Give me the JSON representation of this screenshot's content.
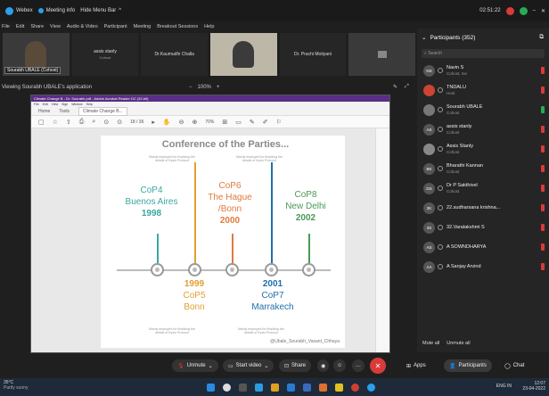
{
  "topbar": {
    "webex": "Webex",
    "meeting_info": "Meeting info",
    "hide_menu": "Hide Menu Bar",
    "time": "02:51:22"
  },
  "menu": [
    "File",
    "Edit",
    "Share",
    "View",
    "Audio & Video",
    "Participant",
    "Meeting",
    "Breakout Sessions",
    "Help"
  ],
  "thumbs": [
    {
      "name": "Sourabh UBALE (Cohost)",
      "sub": "",
      "video": true
    },
    {
      "name": "assis stanly",
      "sub": "Cohost",
      "video": false
    },
    {
      "name": "Dr.Kaumudhi Challa",
      "sub": "",
      "video": false
    },
    {
      "name": "",
      "sub": "",
      "video": true
    },
    {
      "name": "Dr. Prachi Motiyani",
      "sub": "",
      "video": false
    },
    {
      "name": "",
      "sub": "",
      "video": false
    }
  ],
  "viewbar": {
    "label": "Viewing Sourabh UBALE's application",
    "zoom_minus": "−",
    "zoom": "100%",
    "zoom_plus": "+"
  },
  "acrobat": {
    "title": "Climate Change B - Dr. Sourabh.pdf - Adobe Acrobat Reader DC (32-bit)",
    "menu": [
      "File",
      "Edit",
      "View",
      "Sign",
      "Window",
      "Help"
    ],
    "tabs": [
      "Home",
      "Tools",
      "Climate Change B..."
    ],
    "page": "18 / 36",
    "zoom": "70%"
  },
  "slide": {
    "title": "Conference of the Parties...",
    "note_top": "Mainly employed for finalizing the details of Kyoto Protocol",
    "note_bottom": "Mainly employed for finalizing the details of Kyoto Protocol",
    "events_top": [
      {
        "label": "CoP4",
        "place": "Buenos Aires",
        "year": "1998",
        "color": "#3aa7a0"
      },
      {
        "label": "CoP6",
        "place": "The Hague /Bonn",
        "year": "2000",
        "color": "#e07a3c"
      },
      {
        "label": "CoP8",
        "place": "New Delhi",
        "year": "2002",
        "color": "#4a9a55"
      }
    ],
    "events_bottom": [
      {
        "year": "1999",
        "label": "CoP5",
        "place": "Bonn",
        "color": "#e0a030"
      },
      {
        "year": "2001",
        "label": "CoP7",
        "place": "Marrakech",
        "color": "#1f6fa8"
      }
    ],
    "credit": "@Ubale_Sourabh_Vasant_Chhaya"
  },
  "panel": {
    "title": "Participants (352)",
    "search_placeholder": "Search",
    "participants": [
      {
        "initials": "NS",
        "name": "Navin S",
        "role": "Cohost, me",
        "av": "#555"
      },
      {
        "initials": "",
        "name": "TNDALU",
        "role": "Host",
        "av": "#c43"
      },
      {
        "initials": "",
        "name": "Sourabh UBALE",
        "role": "Cohost",
        "av": "#777"
      },
      {
        "initials": "AS",
        "name": "assis stanly",
        "role": "Cohost",
        "av": "#555"
      },
      {
        "initials": "",
        "name": "Assis Stanly",
        "role": "Cohost",
        "av": "#888"
      },
      {
        "initials": "BK",
        "name": "Bharathi Kannan",
        "role": "Cohost",
        "av": "#555"
      },
      {
        "initials": "DS",
        "name": "Dr P Sakthivel",
        "role": "Cohost",
        "av": "#555"
      },
      {
        "initials": "2K",
        "name": "22.sudharsana krishna...",
        "role": "",
        "av": "#555"
      },
      {
        "initials": "3S",
        "name": "32.Varalakshmi S",
        "role": "",
        "av": "#555"
      },
      {
        "initials": "AS",
        "name": "A SOWNDHARYA",
        "role": "",
        "av": "#555"
      },
      {
        "initials": "AA",
        "name": "A Sanjay Arvind",
        "role": "",
        "av": "#555"
      }
    ],
    "mute_all": "Mute all",
    "unmute_all": "Unmute all"
  },
  "controls": {
    "unmute": "Unmute",
    "start_video": "Start video",
    "share": "Share",
    "apps": "Apps",
    "participants": "Participants",
    "chat": "Chat"
  },
  "taskbar": {
    "weather": "35°C",
    "weather_sub": "Partly sunny",
    "lang": "ENG IN",
    "clock": "12:07",
    "date": "23-04-2022"
  }
}
